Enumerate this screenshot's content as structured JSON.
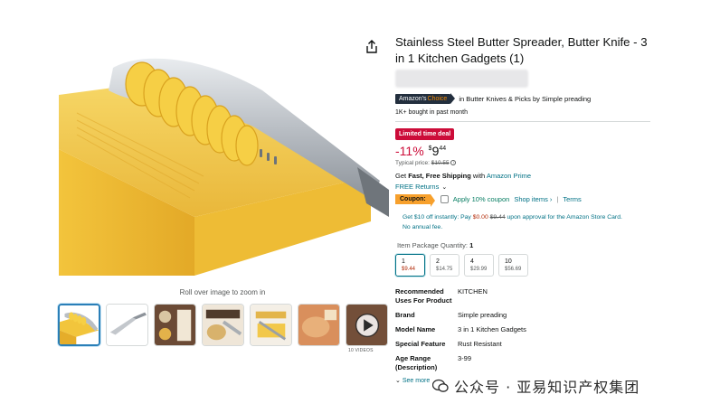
{
  "gallery": {
    "zoom_hint": "Roll over image to zoom in",
    "video_count": "10 VIDEOS",
    "thumbnail_count": 7
  },
  "product": {
    "title": "Stainless Steel Butter Spreader, Butter Knife - 3 in 1 Kitchen Gadgets (1)",
    "choice_badge_left": "Amazon's",
    "choice_badge_right": "Choice",
    "choice_text": "in Butter Knives & Picks by Simple preading",
    "bought": "1K+ bought in past month",
    "deal_badge": "Limited time deal",
    "discount": "-11%",
    "price_symbol": "$",
    "price_whole": "9",
    "price_fraction": "44",
    "typical_label": "Typical price:",
    "typical_price": "$10.55",
    "shipping_prefix": "Get",
    "shipping_bold": "Fast, Free Shipping",
    "shipping_with": "with",
    "shipping_prime": "Amazon Prime",
    "returns": "FREE Returns",
    "coupon_tag": "Coupon:",
    "coupon_apply": "Apply 10% coupon",
    "coupon_link": "Shop items ›",
    "coupon_sep": "|",
    "coupon_terms": "Terms",
    "card_offer_1": "Get $10 off instantly: Pay",
    "card_offer_new": "$0.00",
    "card_offer_old": "$9.44",
    "card_offer_2": "upon approval for the Amazon Store Card.",
    "card_offer_3": "No annual fee.",
    "qty_label": "Item Package Quantity:",
    "qty_value": "1",
    "qty_options": [
      {
        "qty": "1",
        "price": "$9.44"
      },
      {
        "qty": "2",
        "price": "$14.75"
      },
      {
        "qty": "4",
        "price": "$29.99"
      },
      {
        "qty": "10",
        "price": "$56.69"
      }
    ],
    "specs": [
      {
        "key": "Recommended Uses For Product",
        "value": "KITCHEN"
      },
      {
        "key": "Brand",
        "value": "Simple preading"
      },
      {
        "key": "Model Name",
        "value": "3 in 1 Kitchen Gadgets"
      },
      {
        "key": "Special Feature",
        "value": "Rust Resistant"
      },
      {
        "key": "Age Range (Description)",
        "value": "3-99"
      }
    ],
    "see_more": "See more"
  },
  "watermark": "公众号 · 亚易知识产权集团",
  "colors": {
    "deal_red": "#cc0c39",
    "link_teal": "#007185",
    "coupon_orange": "#f7a02c",
    "butter": "#f5c93a",
    "choice_dark": "#232f3e"
  }
}
